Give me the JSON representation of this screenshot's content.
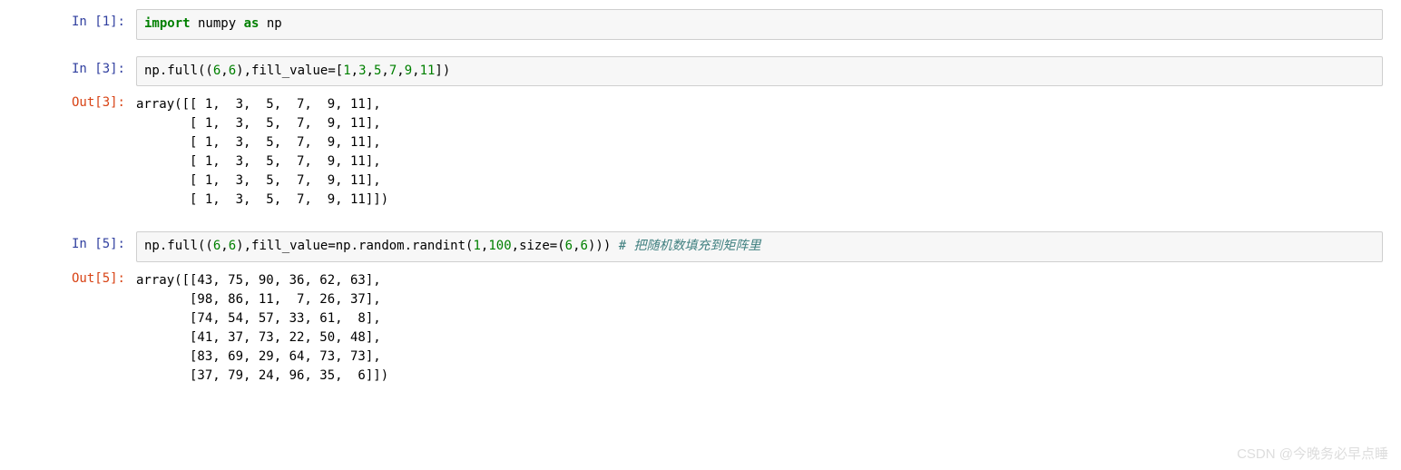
{
  "cells": {
    "c1": {
      "prompt": "In  [1]:",
      "code": {
        "import": "import",
        "module": " numpy ",
        "as": "as",
        "alias": " np"
      }
    },
    "c2": {
      "prompt": "In  [3]:",
      "code": {
        "prefix": "np.full((",
        "a": "6",
        "comma1": ",",
        "b": "6",
        "mid": "),fill_value=[",
        "v1": "1",
        "v2": "3",
        "v3": "5",
        "v4": "7",
        "v5": "9",
        "v6": "11",
        "suffix": "])"
      }
    },
    "c2out": {
      "prompt": "Out[3]:",
      "text": "array([[ 1,  3,  5,  7,  9, 11],\n       [ 1,  3,  5,  7,  9, 11],\n       [ 1,  3,  5,  7,  9, 11],\n       [ 1,  3,  5,  7,  9, 11],\n       [ 1,  3,  5,  7,  9, 11],\n       [ 1,  3,  5,  7,  9, 11]])"
    },
    "c3": {
      "prompt": "In  [5]:",
      "code": {
        "prefix": "np.full((",
        "a": "6",
        "comma1": ",",
        "b": "6",
        "mid": "),fill_value=np.random.randint(",
        "lo": "1",
        "comma2": ",",
        "hi": "100",
        "sizearg": ",size=(",
        "s1": "6",
        "comma3": ",",
        "s2": "6",
        "suffix": ")))   ",
        "comment": "# 把随机数填充到矩阵里"
      }
    },
    "c3out": {
      "prompt": "Out[5]:",
      "text": "array([[43, 75, 90, 36, 62, 63],\n       [98, 86, 11,  7, 26, 37],\n       [74, 54, 57, 33, 61,  8],\n       [41, 37, 73, 22, 50, 48],\n       [83, 69, 29, 64, 73, 73],\n       [37, 79, 24, 96, 35,  6]])"
    }
  },
  "watermark": "CSDN @今晚务必早点睡"
}
